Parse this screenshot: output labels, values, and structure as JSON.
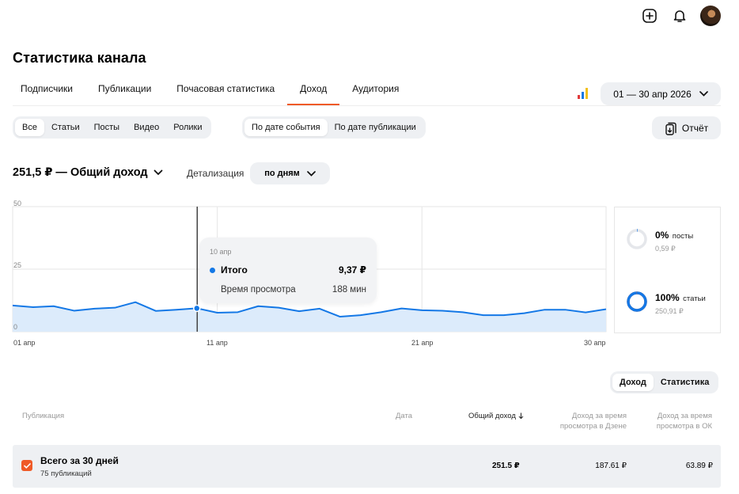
{
  "header": {
    "add_icon": "plus-square-icon",
    "bell_icon": "bell-icon"
  },
  "page_title": "Статистика канала",
  "tabs": [
    {
      "label": "Подписчики",
      "active": false
    },
    {
      "label": "Публикации",
      "active": false
    },
    {
      "label": "Почасовая статистика",
      "active": false
    },
    {
      "label": "Доход",
      "active": true
    },
    {
      "label": "Аудитория",
      "active": false
    }
  ],
  "date_range": "01 — 30 апр 2026",
  "content_filter": [
    "Все",
    "Статьи",
    "Посты",
    "Видео",
    "Ролики"
  ],
  "date_mode": [
    "По дате события",
    "По дате публикации"
  ],
  "report_button": "Отчёт",
  "summary": {
    "title": "251,5 ₽ — Общий доход",
    "detail_label": "Детализация",
    "detail_value": "по дням"
  },
  "chart_data": {
    "type": "area",
    "x": [
      "01 апр",
      "02 апр",
      "03 апр",
      "04 апр",
      "05 апр",
      "06 апр",
      "07 апр",
      "08 апр",
      "09 апр",
      "10 апр",
      "11 апр",
      "12 апр",
      "13 апр",
      "14 апр",
      "15 апр",
      "16 апр",
      "17 апр",
      "18 апр",
      "19 апр",
      "20 апр",
      "21 апр",
      "22 апр",
      "23 апр",
      "24 апр",
      "25 апр",
      "26 апр",
      "27 апр",
      "28 апр",
      "29 апр",
      "30 апр"
    ],
    "values": [
      10.5,
      9.8,
      10.2,
      8.4,
      9.2,
      9.6,
      11.8,
      8.3,
      8.8,
      9.37,
      7.6,
      7.8,
      10.2,
      9.6,
      8.2,
      9.2,
      6.0,
      6.6,
      7.8,
      9.3,
      8.6,
      8.4,
      7.8,
      6.6,
      6.6,
      7.4,
      8.8,
      8.8,
      7.7,
      9.0
    ],
    "yticks": [
      0,
      25,
      50
    ],
    "xticks": [
      "01 апр",
      "11 апр",
      "21 апр",
      "30 апр"
    ],
    "ylim": [
      0,
      50
    ],
    "color": "#1478e6",
    "fill": "#dcebfb",
    "hover_index": 9
  },
  "tooltip": {
    "date": "10 апр",
    "total_label": "Итого",
    "total_value": "9,37 ₽",
    "time_label": "Время просмотра",
    "time_value": "188 мин"
  },
  "share": [
    {
      "pct": "0%",
      "kind": "посты",
      "sub": "0,59 ₽",
      "fraction": 0.01,
      "color": "#1478e6"
    },
    {
      "pct": "100%",
      "kind": "статьи",
      "sub": "250,91 ₽",
      "fraction": 0.99,
      "color": "#1478e6",
      "accent": "#ef5a27"
    }
  ],
  "table_toggle": [
    "Доход",
    "Статистика"
  ],
  "table": {
    "headers": {
      "publication": "Публикация",
      "date": "Дата",
      "total": "Общий доход",
      "dzen_1": "Доход за время",
      "dzen_2": "просмотра в Дзене",
      "ok_1": "Доход за время",
      "ok_2": "просмотра в ОК"
    },
    "total_row": {
      "title": "Всего за 30 дней",
      "sub": "75 публикаций",
      "total": "251.5 ₽",
      "dzen": "187.61 ₽",
      "ok": "63.89 ₽"
    }
  }
}
